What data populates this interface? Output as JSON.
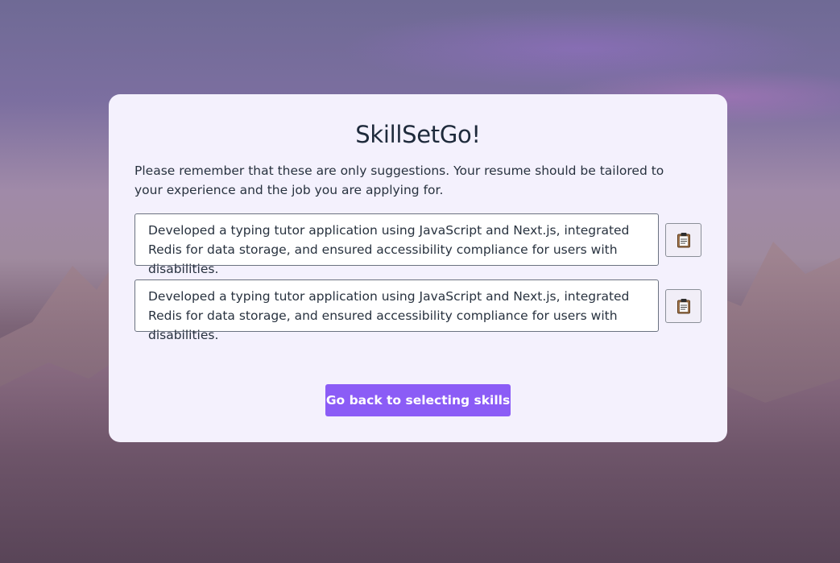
{
  "app": {
    "title": "SkillSetGo!",
    "note": "Please remember that these are only suggestions. Your resume should be tailored to your experience and the job you are applying for."
  },
  "suggestions": [
    {
      "text": "Developed a typing tutor application using JavaScript and Next.js, integrated Redis for data storage, and ensured accessibility compliance for users with disabilities.",
      "copy_icon": "clipboard-icon"
    },
    {
      "text": "Developed a typing tutor application using JavaScript and Next.js, integrated Redis for data storage, and ensured accessibility compliance for users with disabilities.",
      "copy_icon": "clipboard-icon"
    }
  ],
  "actions": {
    "back_label": "Go back to selecting skills"
  },
  "colors": {
    "accent": "#8b5cf6",
    "card_background": "#f4f1fd",
    "title_text": "#1e2a3b"
  }
}
